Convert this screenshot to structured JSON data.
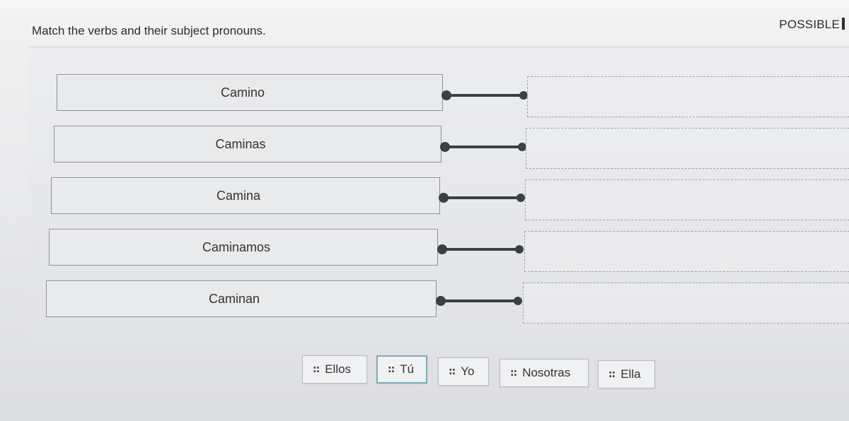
{
  "header": {
    "instruction": "Match the verbs and their subject pronouns.",
    "points_label": "POSSIBLE"
  },
  "verbs": [
    {
      "label": "Camino"
    },
    {
      "label": "Caminas"
    },
    {
      "label": "Camina"
    },
    {
      "label": "Caminamos"
    },
    {
      "label": "Caminan"
    }
  ],
  "answer_chips": [
    {
      "label": "Ellos",
      "grip": "::"
    },
    {
      "label": "Tú",
      "grip": "::",
      "selected": true
    },
    {
      "label": "Yo",
      "grip": "::"
    },
    {
      "label": "Nosotras",
      "grip": "::"
    },
    {
      "label": "Ella",
      "grip": "::"
    }
  ],
  "colors": {
    "connector": "#3a3f48",
    "selected_border": "#7fa9b8"
  }
}
